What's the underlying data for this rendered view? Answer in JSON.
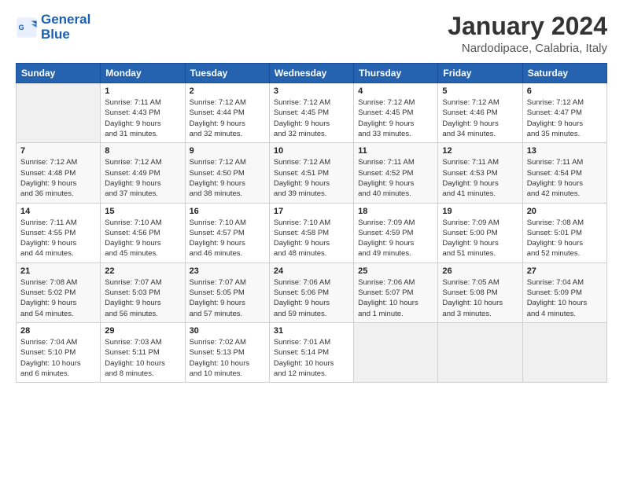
{
  "logo": {
    "line1": "General",
    "line2": "Blue"
  },
  "title": "January 2024",
  "subtitle": "Nardodipace, Calabria, Italy",
  "days_header": [
    "Sunday",
    "Monday",
    "Tuesday",
    "Wednesday",
    "Thursday",
    "Friday",
    "Saturday"
  ],
  "weeks": [
    [
      {
        "day": "",
        "info": ""
      },
      {
        "day": "1",
        "info": "Sunrise: 7:11 AM\nSunset: 4:43 PM\nDaylight: 9 hours\nand 31 minutes."
      },
      {
        "day": "2",
        "info": "Sunrise: 7:12 AM\nSunset: 4:44 PM\nDaylight: 9 hours\nand 32 minutes."
      },
      {
        "day": "3",
        "info": "Sunrise: 7:12 AM\nSunset: 4:45 PM\nDaylight: 9 hours\nand 32 minutes."
      },
      {
        "day": "4",
        "info": "Sunrise: 7:12 AM\nSunset: 4:45 PM\nDaylight: 9 hours\nand 33 minutes."
      },
      {
        "day": "5",
        "info": "Sunrise: 7:12 AM\nSunset: 4:46 PM\nDaylight: 9 hours\nand 34 minutes."
      },
      {
        "day": "6",
        "info": "Sunrise: 7:12 AM\nSunset: 4:47 PM\nDaylight: 9 hours\nand 35 minutes."
      }
    ],
    [
      {
        "day": "7",
        "info": "Sunrise: 7:12 AM\nSunset: 4:48 PM\nDaylight: 9 hours\nand 36 minutes."
      },
      {
        "day": "8",
        "info": "Sunrise: 7:12 AM\nSunset: 4:49 PM\nDaylight: 9 hours\nand 37 minutes."
      },
      {
        "day": "9",
        "info": "Sunrise: 7:12 AM\nSunset: 4:50 PM\nDaylight: 9 hours\nand 38 minutes."
      },
      {
        "day": "10",
        "info": "Sunrise: 7:12 AM\nSunset: 4:51 PM\nDaylight: 9 hours\nand 39 minutes."
      },
      {
        "day": "11",
        "info": "Sunrise: 7:11 AM\nSunset: 4:52 PM\nDaylight: 9 hours\nand 40 minutes."
      },
      {
        "day": "12",
        "info": "Sunrise: 7:11 AM\nSunset: 4:53 PM\nDaylight: 9 hours\nand 41 minutes."
      },
      {
        "day": "13",
        "info": "Sunrise: 7:11 AM\nSunset: 4:54 PM\nDaylight: 9 hours\nand 42 minutes."
      }
    ],
    [
      {
        "day": "14",
        "info": "Sunrise: 7:11 AM\nSunset: 4:55 PM\nDaylight: 9 hours\nand 44 minutes."
      },
      {
        "day": "15",
        "info": "Sunrise: 7:10 AM\nSunset: 4:56 PM\nDaylight: 9 hours\nand 45 minutes."
      },
      {
        "day": "16",
        "info": "Sunrise: 7:10 AM\nSunset: 4:57 PM\nDaylight: 9 hours\nand 46 minutes."
      },
      {
        "day": "17",
        "info": "Sunrise: 7:10 AM\nSunset: 4:58 PM\nDaylight: 9 hours\nand 48 minutes."
      },
      {
        "day": "18",
        "info": "Sunrise: 7:09 AM\nSunset: 4:59 PM\nDaylight: 9 hours\nand 49 minutes."
      },
      {
        "day": "19",
        "info": "Sunrise: 7:09 AM\nSunset: 5:00 PM\nDaylight: 9 hours\nand 51 minutes."
      },
      {
        "day": "20",
        "info": "Sunrise: 7:08 AM\nSunset: 5:01 PM\nDaylight: 9 hours\nand 52 minutes."
      }
    ],
    [
      {
        "day": "21",
        "info": "Sunrise: 7:08 AM\nSunset: 5:02 PM\nDaylight: 9 hours\nand 54 minutes."
      },
      {
        "day": "22",
        "info": "Sunrise: 7:07 AM\nSunset: 5:03 PM\nDaylight: 9 hours\nand 56 minutes."
      },
      {
        "day": "23",
        "info": "Sunrise: 7:07 AM\nSunset: 5:05 PM\nDaylight: 9 hours\nand 57 minutes."
      },
      {
        "day": "24",
        "info": "Sunrise: 7:06 AM\nSunset: 5:06 PM\nDaylight: 9 hours\nand 59 minutes."
      },
      {
        "day": "25",
        "info": "Sunrise: 7:06 AM\nSunset: 5:07 PM\nDaylight: 10 hours\nand 1 minute."
      },
      {
        "day": "26",
        "info": "Sunrise: 7:05 AM\nSunset: 5:08 PM\nDaylight: 10 hours\nand 3 minutes."
      },
      {
        "day": "27",
        "info": "Sunrise: 7:04 AM\nSunset: 5:09 PM\nDaylight: 10 hours\nand 4 minutes."
      }
    ],
    [
      {
        "day": "28",
        "info": "Sunrise: 7:04 AM\nSunset: 5:10 PM\nDaylight: 10 hours\nand 6 minutes."
      },
      {
        "day": "29",
        "info": "Sunrise: 7:03 AM\nSunset: 5:11 PM\nDaylight: 10 hours\nand 8 minutes."
      },
      {
        "day": "30",
        "info": "Sunrise: 7:02 AM\nSunset: 5:13 PM\nDaylight: 10 hours\nand 10 minutes."
      },
      {
        "day": "31",
        "info": "Sunrise: 7:01 AM\nSunset: 5:14 PM\nDaylight: 10 hours\nand 12 minutes."
      },
      {
        "day": "",
        "info": ""
      },
      {
        "day": "",
        "info": ""
      },
      {
        "day": "",
        "info": ""
      }
    ]
  ]
}
